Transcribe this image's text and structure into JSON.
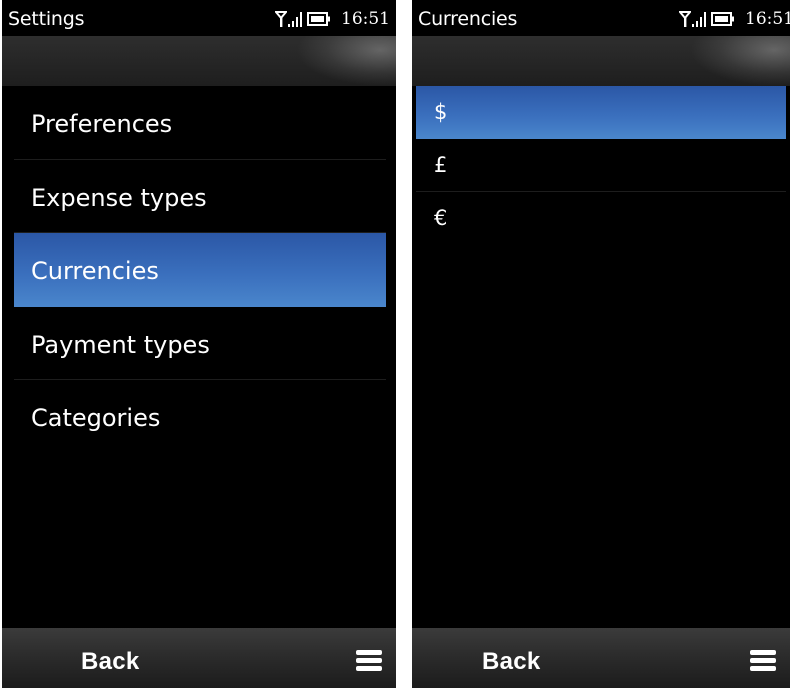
{
  "left_screen": {
    "status": {
      "title": "Settings",
      "time": "16:51",
      "icons": [
        "signal-antenna-icon",
        "signal-bars-icon",
        "battery-icon"
      ]
    },
    "list": [
      {
        "label": "Preferences",
        "selected": false
      },
      {
        "label": "Expense types",
        "selected": false
      },
      {
        "label": "Currencies",
        "selected": true
      },
      {
        "label": "Payment types",
        "selected": false
      },
      {
        "label": "Categories",
        "selected": false
      }
    ],
    "bottom_bar": {
      "back_label": "Back",
      "menu_icon": "hamburger-menu-icon"
    }
  },
  "right_screen": {
    "status": {
      "title": "Currencies",
      "time": "16:51",
      "icons": [
        "signal-antenna-icon",
        "signal-bars-icon",
        "battery-icon"
      ]
    },
    "list": [
      {
        "label": "$",
        "selected": true
      },
      {
        "label": "£",
        "selected": false
      },
      {
        "label": "€",
        "selected": false
      }
    ],
    "bottom_bar": {
      "back_label": "Back",
      "menu_icon": "hamburger-menu-icon"
    }
  },
  "colors": {
    "background": "#000000",
    "highlight_top": "#2b57a6",
    "highlight_bottom": "#4a86cc",
    "text": "#ffffff"
  }
}
